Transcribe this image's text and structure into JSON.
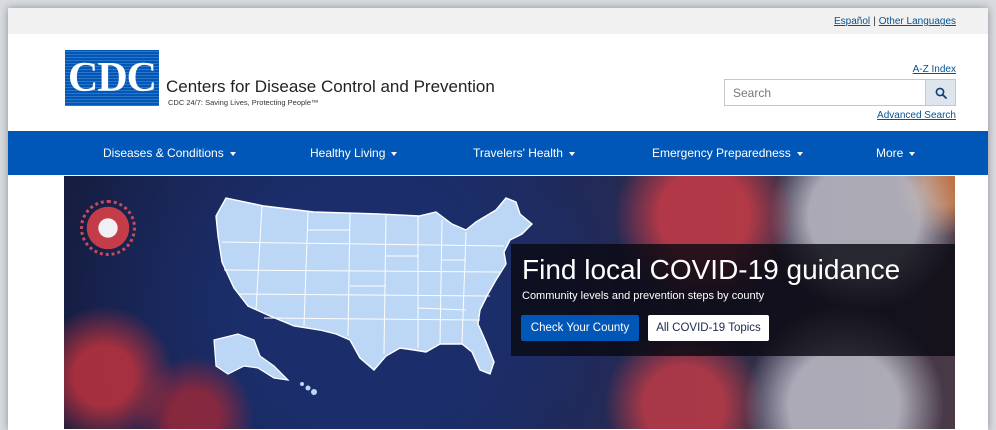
{
  "utility": {
    "language_spanish": "Español",
    "separator": "|",
    "language_other": "Other Languages"
  },
  "header": {
    "logo_text": "CDC",
    "org_name": "Centers for Disease Control and Prevention",
    "tagline": "CDC 24/7: Saving Lives, Protecting People™",
    "az_index": "A-Z Index",
    "search_placeholder": "Search",
    "search_icon": "search-icon",
    "advanced_search": "Advanced Search"
  },
  "nav": {
    "items": [
      {
        "label": "Diseases & Conditions"
      },
      {
        "label": "Healthy Living"
      },
      {
        "label": "Travelers' Health"
      },
      {
        "label": "Emergency Preparedness"
      },
      {
        "label": "More"
      }
    ]
  },
  "hero": {
    "title": "Find local COVID-19 guidance",
    "subtitle": "Community levels and prevention steps by county",
    "primary_button": "Check Your County",
    "secondary_button": "All COVID-19 Topics"
  },
  "colors": {
    "brand_blue": "#0057b7",
    "link_blue": "#075290",
    "overlay": "#0a0a12"
  }
}
